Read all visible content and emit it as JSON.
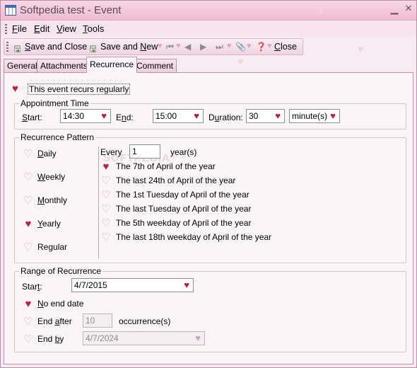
{
  "window": {
    "title": "Softpedia test - Event"
  },
  "menu": [
    {
      "pre": "",
      "hot": "F",
      "post": "ile"
    },
    {
      "pre": "",
      "hot": "E",
      "post": "dit"
    },
    {
      "pre": "",
      "hot": "V",
      "post": "iew"
    },
    {
      "pre": "",
      "hot": "T",
      "post": "ools"
    }
  ],
  "toolbar": {
    "save_close": {
      "pre": "",
      "hot": "S",
      "post": "ave and Close"
    },
    "save_new": {
      "pre": "Save and ",
      "hot": "N",
      "post": "ew"
    },
    "close": {
      "pre": "",
      "hot": "C",
      "post": "lose"
    }
  },
  "tabs": [
    "General",
    "Attachments",
    "Recurrence",
    "Comment"
  ],
  "recurs_regularly": "This event recurs regularly",
  "appointment": {
    "title": "Appointment Time",
    "start": {
      "pre": "",
      "hot": "S",
      "post": "tart:"
    },
    "start_value": "14:30",
    "end": {
      "pre": "E",
      "hot": "n",
      "post": "d:"
    },
    "end_value": "15:00",
    "duration": {
      "pre": "D",
      "hot": "u",
      "post": "ration:"
    },
    "duration_value": "30",
    "duration_unit": "minute(s)"
  },
  "pattern": {
    "title": "Recurrence Pattern",
    "types": [
      {
        "pre": "",
        "hot": "D",
        "post": "aily",
        "selected": false
      },
      {
        "pre": "",
        "hot": "W",
        "post": "eekly",
        "selected": false
      },
      {
        "pre": "",
        "hot": "M",
        "post": "onthly",
        "selected": false
      },
      {
        "pre": "",
        "hot": "Y",
        "post": "early",
        "selected": true
      },
      {
        "pre": "Re",
        "hot": "g",
        "post": "ular",
        "selected": false
      }
    ],
    "every_label": "Every",
    "every_value": "1",
    "every_unit": "year(s)",
    "options": [
      {
        "label": "The 7th of April of the year",
        "selected": true
      },
      {
        "label": "The last 24th of April of the year",
        "selected": false
      },
      {
        "label": "The 1st Tuesday of April of the year",
        "selected": false
      },
      {
        "label": "The last Tuesday of April of the year",
        "selected": false
      },
      {
        "label": "The 5th weekday of April of the year",
        "selected": false
      },
      {
        "label": "The last 18th weekday of April of the year",
        "selected": false
      }
    ]
  },
  "range": {
    "title": "Range of Recurrence",
    "start": {
      "pre": "Star",
      "hot": "t",
      "post": ":"
    },
    "start_value": "4/7/2015",
    "no_end": {
      "pre": "",
      "hot": "N",
      "post": "o end date",
      "selected": true
    },
    "end_after": {
      "pre": "End ",
      "hot": "a",
      "post": "fter",
      "selected": false
    },
    "end_after_value": "10",
    "occurrences_label": "occurrence(s)",
    "end_by": {
      "pre": "End ",
      "hot": "b",
      "post": "y",
      "selected": false
    },
    "end_by_value": "4/7/2024"
  },
  "icons": {
    "heart_on": "♥",
    "heart_off": "♡"
  }
}
